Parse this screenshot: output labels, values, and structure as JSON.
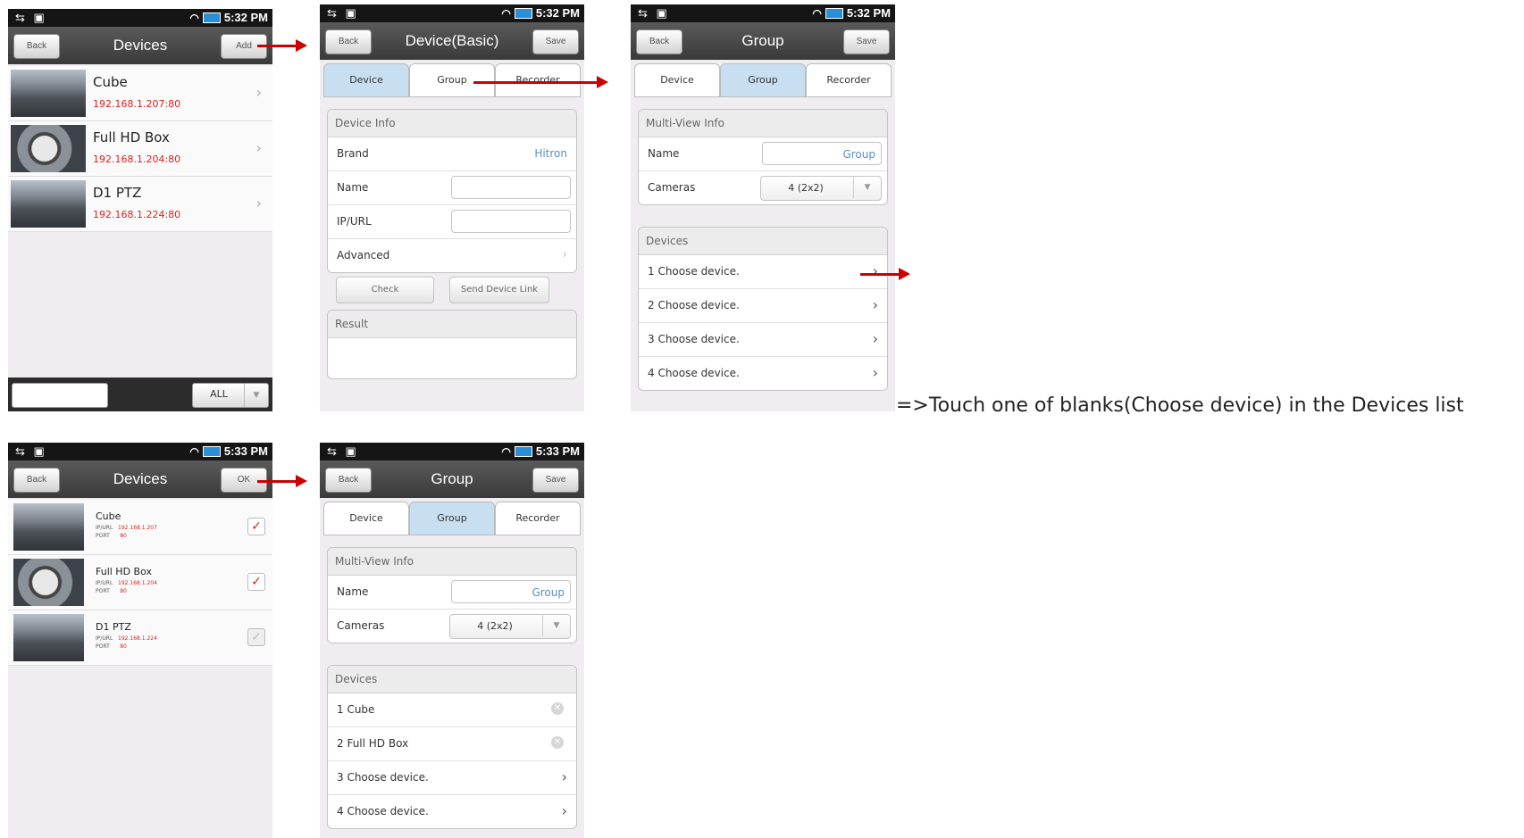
{
  "status": {
    "icons_left": "usb-debug android",
    "time_a": "5:32 PM",
    "time_b": "5:33 PM"
  },
  "devices_list": {
    "back": "Back",
    "title": "Devices",
    "add": "Add",
    "items": [
      {
        "name": "Cube",
        "ip": "192.168.1.207:80"
      },
      {
        "name": "Full HD Box",
        "ip": "192.168.1.204:80"
      },
      {
        "name": "D1 PTZ",
        "ip": "192.168.1.224:80"
      }
    ],
    "filter_value": "ALL"
  },
  "device_basic": {
    "back": "Back",
    "title": "Device(Basic)",
    "save": "Save",
    "tabs": [
      "Device",
      "Group",
      "Recorder"
    ],
    "info_header": "Device Info",
    "brand_label": "Brand",
    "brand_value": "Hitron",
    "name_label": "Name",
    "ip_label": "IP/URL",
    "advanced_label": "Advanced",
    "check_button": "Check",
    "send_button": "Send Device Link",
    "result_header": "Result"
  },
  "group_screen": {
    "back": "Back",
    "title": "Group",
    "save": "Save",
    "tabs": [
      "Device",
      "Group",
      "Recorder"
    ],
    "multi_header": "Multi-View Info",
    "name_label": "Name",
    "name_value": "Group",
    "cameras_label": "Cameras",
    "cameras_value": "4 (2x2)",
    "devices_header": "Devices",
    "slots": [
      "1  Choose device.",
      "2  Choose device.",
      "3  Choose device.",
      "4  Choose device."
    ]
  },
  "devices_select": {
    "back": "Back",
    "title": "Devices",
    "ok": "OK",
    "ip_label": "IP/URL",
    "port_label": "PORT",
    "items": [
      {
        "name": "Cube",
        "ip": "192.168.1.207",
        "port": "80",
        "checked": true
      },
      {
        "name": "Full HD Box",
        "ip": "192.168.1.204",
        "port": "80",
        "checked": true
      },
      {
        "name": "D1 PTZ",
        "ip": "192.168.1.224",
        "port": "80",
        "checked": false
      }
    ]
  },
  "group_result": {
    "slots": [
      "1  Cube",
      "2  Full HD Box",
      "3  Choose device.",
      "4  Choose device."
    ]
  },
  "instruction": "=>Touch one of blanks(Choose device) in the Devices list",
  "colors": {
    "arrow": "#cc0000",
    "active_tab": "#c7dff1",
    "ip_text": "#dd2222"
  }
}
